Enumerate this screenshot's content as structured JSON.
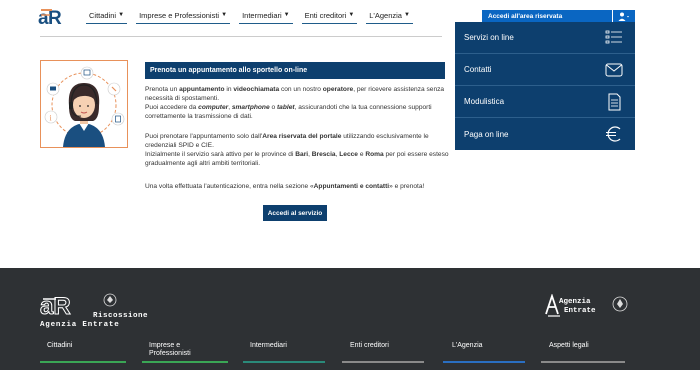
{
  "header": {
    "logo_alt": "aER",
    "nav": [
      {
        "label": "Cittadini"
      },
      {
        "label": "Imprese e Professionisti"
      },
      {
        "label": "Intermediari"
      },
      {
        "label": "Enti creditori"
      },
      {
        "label": "L'Agenzia"
      }
    ],
    "area_riservata_label": "Accedi all'area riservata",
    "user_icon": "user-icon"
  },
  "sidemenu": [
    {
      "label": "Servizi on line",
      "icon": "list-icon"
    },
    {
      "label": "Contatti",
      "icon": "mail-icon"
    },
    {
      "label": "Modulistica",
      "icon": "document-icon"
    },
    {
      "label": "Paga on line",
      "icon": "euro-icon"
    }
  ],
  "content": {
    "title": "Prenota un appuntamento allo sportello on-line",
    "p1_a": "Prenota un ",
    "p1_b": "appuntamento",
    "p1_c": " in ",
    "p1_d": "videochiamata",
    "p1_e": " con un nostro ",
    "p1_f": "operatore",
    "p1_g": ", per ricevere assistenza senza necessità di spostamenti.",
    "p2_a": "Puoi accedere da ",
    "p2_b": "computer",
    "p2_c": ", ",
    "p2_d": "smartphone",
    "p2_e": " o ",
    "p2_f": "tablet",
    "p2_g": ", assicurandoti che la tua connessione supporti correttamente la trasmissione di dati.",
    "p3_a": "Puoi prenotare l'appuntamento solo dall'",
    "p3_b": "Area riservata del portale",
    "p3_c": " utilizzando esclusivamente le credenziali SPID e CIE.",
    "p4_a": "Inizialmente il servizio sarà attivo per le province di ",
    "p4_b": "Bari",
    "p4_c": ", ",
    "p4_d": "Brescia",
    "p4_e": ", ",
    "p4_f": "Lecce",
    "p4_g": " e ",
    "p4_h": "Roma",
    "p4_i": " per poi essere esteso gradualmente agli altri ambiti territoriali.",
    "p5_a": "Una volta effettuata l'autenticazione, entra nella sezione «",
    "p5_b": "Appuntamenti e contatti",
    "p5_c": "» e prenota!",
    "cta_label": "Accedi al servizio"
  },
  "footer": {
    "logo1_line1": "Riscossione",
    "logo1_line2": "Agenzia Entrate",
    "logo2_line1": "Agenzia",
    "logo2_line2": "Entrate",
    "nav": [
      {
        "label": "Cittadini",
        "color": "#3aa655"
      },
      {
        "label": "Imprese e Professionisti",
        "color": "#3aa655"
      },
      {
        "label": "Intermediari",
        "color": "#2a8a7a"
      },
      {
        "label": "Enti creditori",
        "color": "#8a8a8a"
      },
      {
        "label": "L'Agenzia",
        "color": "#2a6fc2"
      },
      {
        "label": "Aspetti legali",
        "color": "#8a8a8a"
      }
    ]
  },
  "colors": {
    "brand_dark": "#0d3f6e",
    "brand_blue": "#0a66c2",
    "accent_orange": "#e8915a",
    "footer_bg": "#2e3134"
  }
}
